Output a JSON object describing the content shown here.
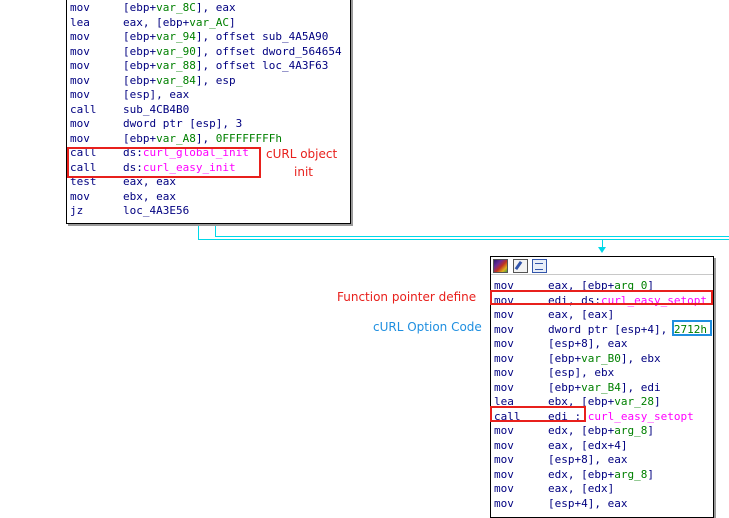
{
  "node1": {
    "lines": [
      {
        "mnemonic": "mov",
        "parts": [
          [
            "[ebp+",
            ""
          ],
          [
            "var_8C",
            "v"
          ],
          [
            "], eax",
            ""
          ]
        ]
      },
      {
        "mnemonic": "lea",
        "parts": [
          [
            "eax, [ebp+",
            ""
          ],
          [
            "var_AC",
            "v"
          ],
          [
            "]",
            ""
          ]
        ]
      },
      {
        "mnemonic": "mov",
        "parts": [
          [
            "[ebp+",
            ""
          ],
          [
            "var_94",
            "v"
          ],
          [
            "], offset sub_4A5A90",
            ""
          ]
        ]
      },
      {
        "mnemonic": "mov",
        "parts": [
          [
            "[ebp+",
            ""
          ],
          [
            "var_90",
            "v"
          ],
          [
            "], offset dword_564654",
            ""
          ]
        ]
      },
      {
        "mnemonic": "mov",
        "parts": [
          [
            "[ebp+",
            ""
          ],
          [
            "var_88",
            "v"
          ],
          [
            "], offset loc_4A3F63",
            ""
          ]
        ]
      },
      {
        "mnemonic": "mov",
        "parts": [
          [
            "[ebp+",
            ""
          ],
          [
            "var_84",
            "v"
          ],
          [
            "], esp",
            ""
          ]
        ]
      },
      {
        "mnemonic": "mov",
        "parts": [
          [
            "[esp], eax",
            ""
          ]
        ]
      },
      {
        "mnemonic": "call",
        "parts": [
          [
            "sub_4CB4B0",
            ""
          ]
        ]
      },
      {
        "mnemonic": "mov",
        "parts": [
          [
            "dword ptr [esp], 3",
            ""
          ]
        ]
      },
      {
        "mnemonic": "mov",
        "parts": [
          [
            "[ebp+",
            ""
          ],
          [
            "var_A8",
            "v"
          ],
          [
            "], ",
            ""
          ],
          [
            "0FFFFFFFFh",
            "n"
          ]
        ]
      },
      {
        "mnemonic": "call",
        "parts": [
          [
            "ds:",
            ""
          ],
          [
            "curl_global_init",
            "f"
          ]
        ]
      },
      {
        "mnemonic": "call",
        "parts": [
          [
            "ds:",
            ""
          ],
          [
            "curl_easy_init",
            "f"
          ]
        ]
      },
      {
        "mnemonic": "test",
        "parts": [
          [
            "eax, eax",
            ""
          ]
        ]
      },
      {
        "mnemonic": "mov",
        "parts": [
          [
            "ebx, eax",
            ""
          ]
        ]
      },
      {
        "mnemonic": "jz",
        "parts": [
          [
            "loc_4A3E56",
            ""
          ]
        ]
      }
    ]
  },
  "node2": {
    "lines": [
      {
        "mnemonic": "mov",
        "parts": [
          [
            "eax, [ebp+",
            ""
          ],
          [
            "arg_0",
            "v"
          ],
          [
            "]",
            ""
          ]
        ]
      },
      {
        "mnemonic": "mov",
        "parts": [
          [
            "edi, ds:",
            ""
          ],
          [
            "curl_easy_setopt",
            "f"
          ]
        ]
      },
      {
        "mnemonic": "mov",
        "parts": [
          [
            "eax, [eax]",
            ""
          ]
        ]
      },
      {
        "mnemonic": "mov",
        "parts": [
          [
            "dword ptr [esp+4], ",
            ""
          ],
          [
            "2712h",
            "n"
          ]
        ]
      },
      {
        "mnemonic": "mov",
        "parts": [
          [
            "[esp+8], eax",
            ""
          ]
        ]
      },
      {
        "mnemonic": "mov",
        "parts": [
          [
            "[ebp+",
            ""
          ],
          [
            "var_B0",
            "v"
          ],
          [
            "], ebx",
            ""
          ]
        ]
      },
      {
        "mnemonic": "mov",
        "parts": [
          [
            "[esp], ebx",
            ""
          ]
        ]
      },
      {
        "mnemonic": "mov",
        "parts": [
          [
            "[ebp+",
            ""
          ],
          [
            "var_B4",
            "v"
          ],
          [
            "], edi",
            ""
          ]
        ]
      },
      {
        "mnemonic": "lea",
        "parts": [
          [
            "ebx, [ebp+",
            ""
          ],
          [
            "var_28",
            "v"
          ],
          [
            "]",
            ""
          ]
        ]
      },
      {
        "mnemonic": "call",
        "parts": [
          [
            "edi ; ",
            ""
          ],
          [
            "curl_easy_setopt",
            "c"
          ]
        ]
      },
      {
        "mnemonic": "mov",
        "parts": [
          [
            "edx, [ebp+",
            ""
          ],
          [
            "arg_8",
            "v"
          ],
          [
            "]",
            ""
          ]
        ]
      },
      {
        "mnemonic": "mov",
        "parts": [
          [
            "eax, [edx+4]",
            ""
          ]
        ]
      },
      {
        "mnemonic": "mov",
        "parts": [
          [
            "[esp+8], eax",
            ""
          ]
        ]
      },
      {
        "mnemonic": "mov",
        "parts": [
          [
            "edx, [ebp+",
            ""
          ],
          [
            "arg_8",
            "v"
          ],
          [
            "]",
            ""
          ]
        ]
      },
      {
        "mnemonic": "mov",
        "parts": [
          [
            "eax, [edx]",
            ""
          ]
        ]
      },
      {
        "mnemonic": "mov",
        "parts": [
          [
            "[esp+4], eax",
            ""
          ]
        ]
      }
    ]
  },
  "annotations": {
    "curl_object_1": "cURL object",
    "curl_object_2": "init",
    "function_pointer": "Function pointer define",
    "option_code": "cURL Option Code"
  },
  "colors": {
    "mnemonic": "#000080",
    "variable": "#008000",
    "import": "#ff00ff",
    "highlight_red": "#e8201c",
    "highlight_blue": "#1f8fe0",
    "edge": "#00d8e8"
  }
}
